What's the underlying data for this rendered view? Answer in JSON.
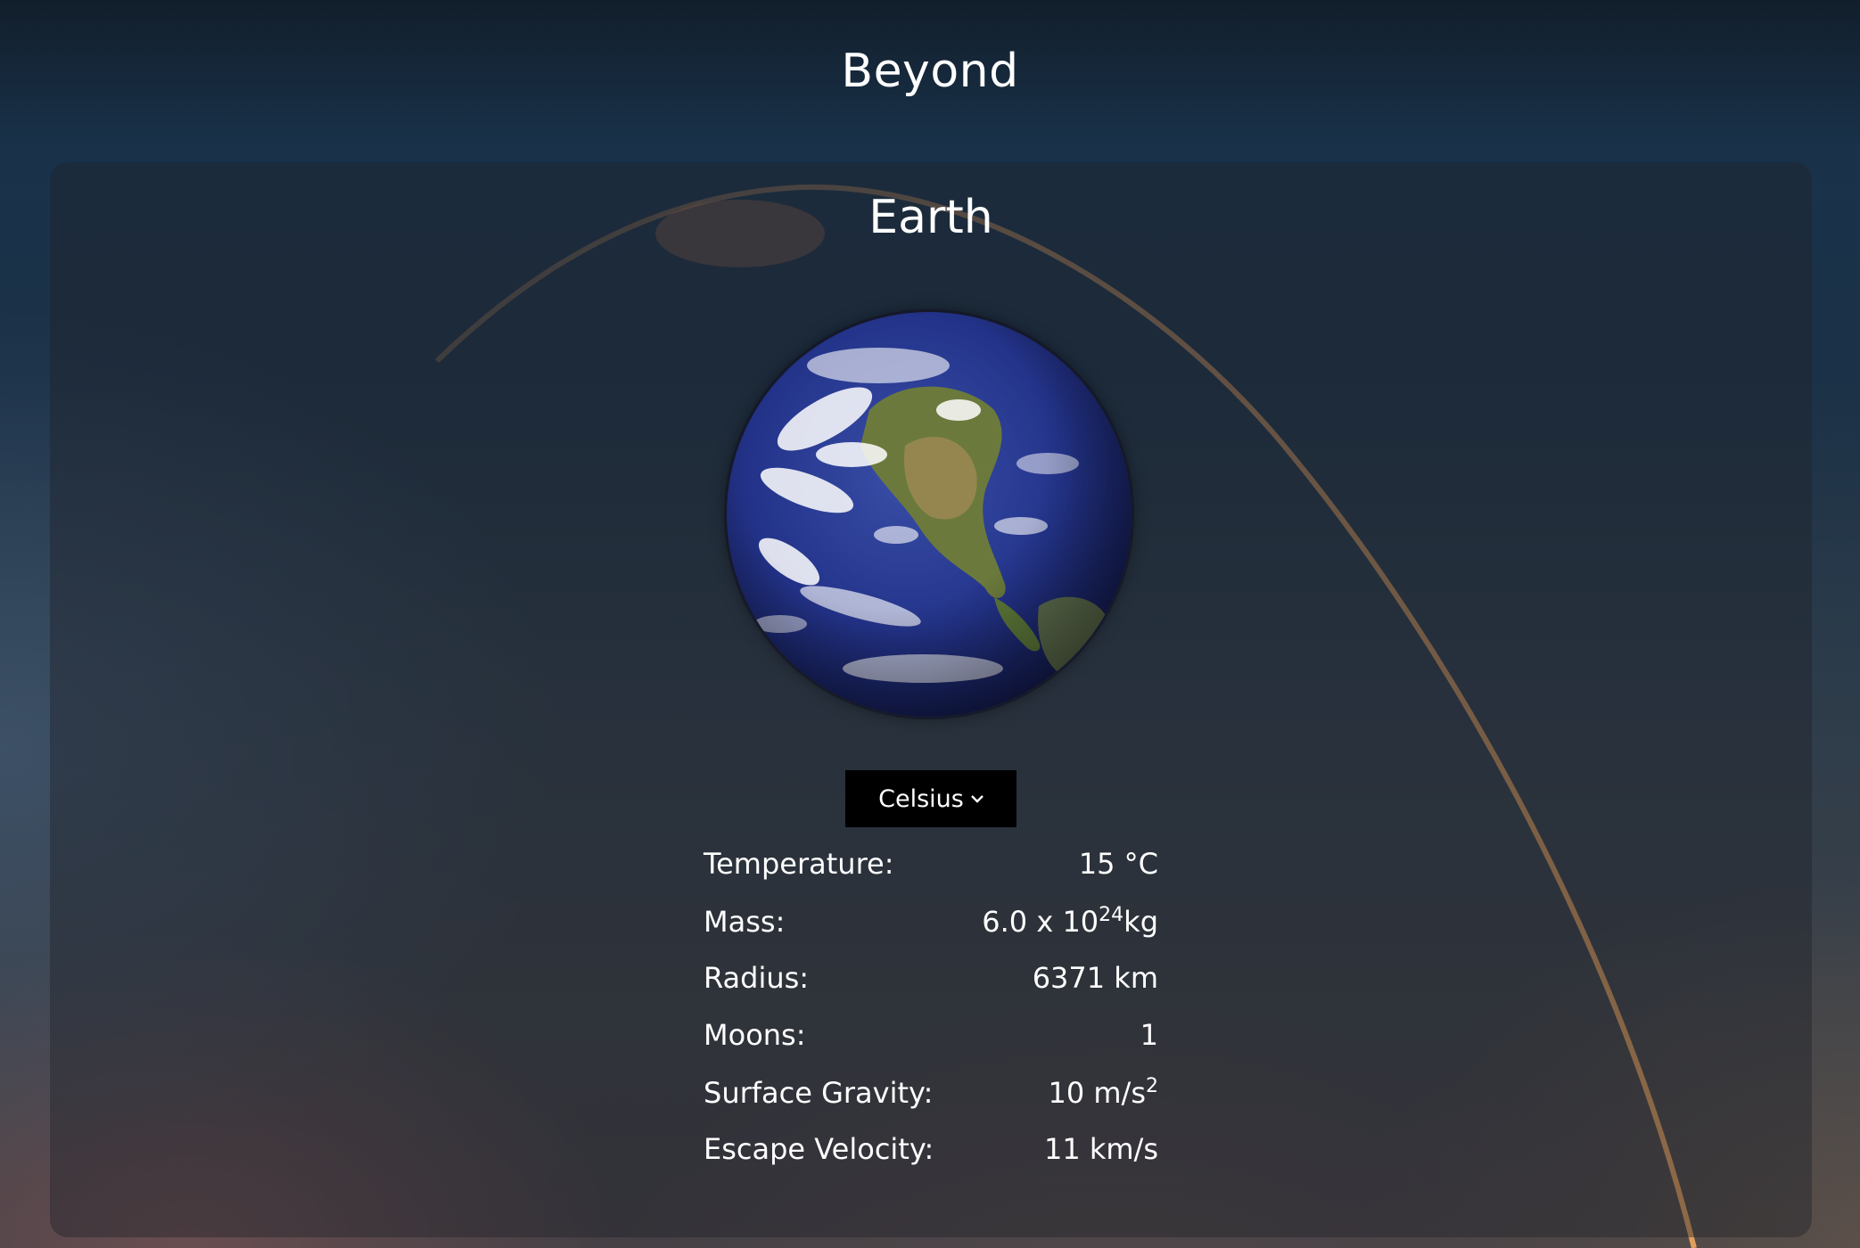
{
  "header": {
    "title": "Beyond"
  },
  "planet": {
    "name": "Earth",
    "image_icon": "earth-globe-image"
  },
  "unit_selector": {
    "selected": "Celsius",
    "icon": "chevron-down-icon"
  },
  "stats": [
    {
      "label": "Temperature:",
      "value": "15 °C"
    },
    {
      "label": "Mass:",
      "value_prefix": "6.0 x 10",
      "value_sup": "24",
      "value_suffix": "kg"
    },
    {
      "label": "Radius:",
      "value": "6371 km"
    },
    {
      "label": "Moons:",
      "value": "1"
    },
    {
      "label": "Surface Gravity:",
      "value_prefix": "10 m/s",
      "value_sup": "2",
      "value_suffix": ""
    },
    {
      "label": "Escape Velocity:",
      "value": "11 km/s"
    }
  ],
  "colors": {
    "select_bg": "#000000",
    "text": "#ffffff",
    "arc": "#e3a05a"
  }
}
